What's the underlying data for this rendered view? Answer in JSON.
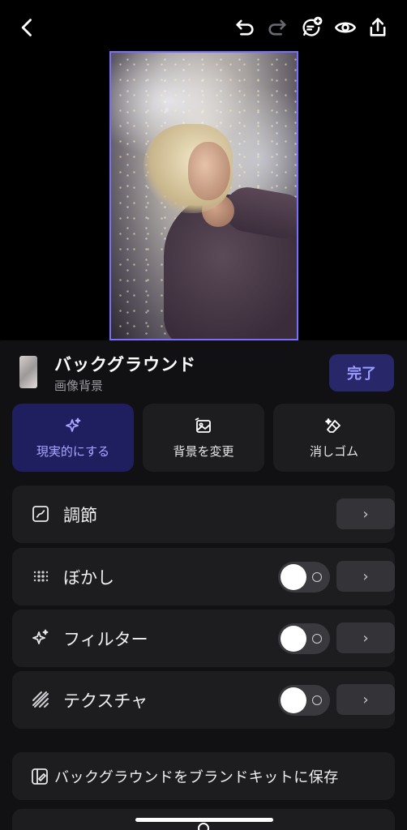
{
  "topbar": {
    "icons": [
      "back-icon",
      "undo-icon",
      "redo-icon",
      "add-comment-icon",
      "preview-eye-icon",
      "share-icon"
    ]
  },
  "canvas": {
    "image_description_icon": "photo-icon"
  },
  "panel": {
    "title": "バックグラウンド",
    "subtitle": "画像背景",
    "done_label": "完了",
    "tools": [
      {
        "label": "現実的にする",
        "icon": "sparkle-icon",
        "active": true
      },
      {
        "label": "背景を変更",
        "icon": "image-swap-icon",
        "active": false
      },
      {
        "label": "消しゴム",
        "icon": "eraser-icon",
        "active": false
      }
    ],
    "rows": [
      {
        "label": "調節",
        "icon": "adjust-icon",
        "has_toggle": false
      },
      {
        "label": "ぼかし",
        "icon": "blur-icon",
        "has_toggle": true,
        "toggle_on": false
      },
      {
        "label": "フィルター",
        "icon": "filter-sparkle-icon",
        "has_toggle": true,
        "toggle_on": false
      },
      {
        "label": "テクスチャ",
        "icon": "texture-icon",
        "has_toggle": true,
        "toggle_on": false
      }
    ],
    "chevron": "›",
    "save_label": "バックグラウンドをブランドキットに保存"
  },
  "colors": {
    "accent": "#7a6dff",
    "active_tile_bg": "#1f1e5e",
    "active_text": "#a9a8ff",
    "panel_bg": "#111113",
    "row_bg": "#1d1d20"
  }
}
